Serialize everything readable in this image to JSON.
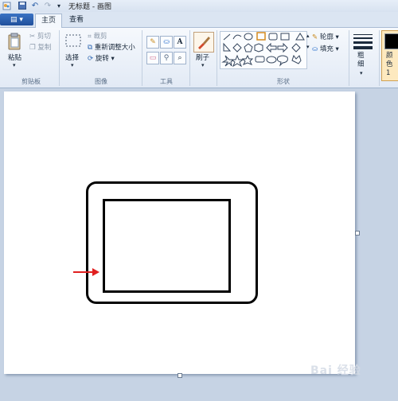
{
  "window": {
    "title": "无标题 - 画图"
  },
  "tabs": [
    {
      "label": "主页"
    },
    {
      "label": "查看"
    }
  ],
  "ribbon": {
    "clipboard": {
      "paste": "粘贴",
      "cut": "剪切",
      "copy": "复制",
      "group": "剪贴板"
    },
    "image": {
      "select": "选择",
      "crop": "裁剪",
      "resize": "重新调整大小",
      "rotate": "旋转",
      "group": "图像"
    },
    "tools": {
      "group": "工具"
    },
    "brushes": {
      "label": "刷子"
    },
    "shapes": {
      "outline": "轮廓",
      "fill": "填充",
      "group": "形状"
    },
    "size": {
      "label": "粗细"
    },
    "colors": {
      "label": "颜色 1",
      "color1": "#000000"
    }
  },
  "watermark": "Bai 经验",
  "colors": {
    "accent": "#1f4f9b",
    "arrow": "#e02020"
  }
}
